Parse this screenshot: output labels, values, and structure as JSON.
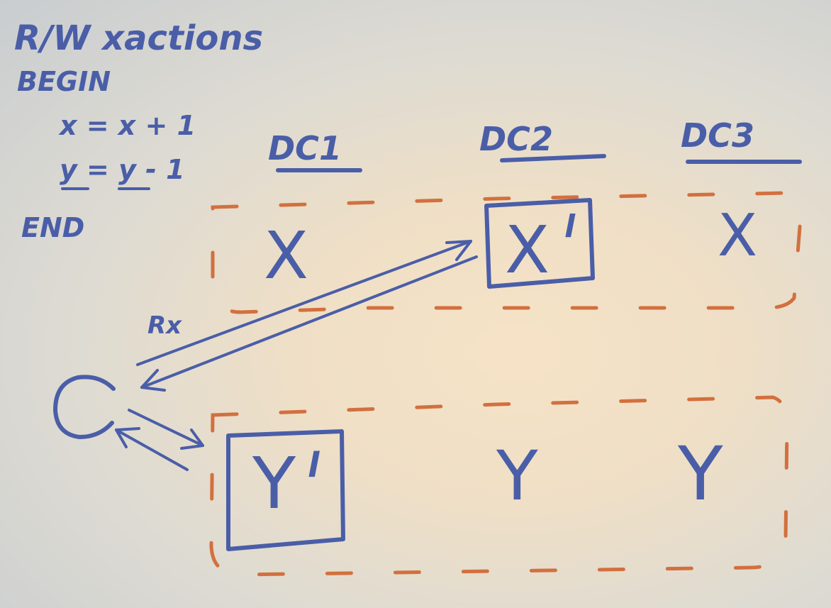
{
  "code": {
    "heading": "R/W xactions",
    "begin": "BEGIN",
    "line1": "x = x + 1",
    "line2": "y = y - 1",
    "end": "END"
  },
  "datacenters": [
    "DC1",
    "DC2",
    "DC3"
  ],
  "row_x": {
    "dc1": "X",
    "dc2": "X",
    "dc2_lock": "l",
    "dc3": "X"
  },
  "row_y": {
    "dc1": "Y",
    "dc1_lock": "l",
    "dc2": "Y",
    "dc3": "Y"
  },
  "client": {
    "label": "C",
    "arrow_label": "Rx"
  },
  "colors": {
    "ink": "#4a5ea8",
    "dashed_group": "#d2703e",
    "board": "#efdfc6"
  }
}
